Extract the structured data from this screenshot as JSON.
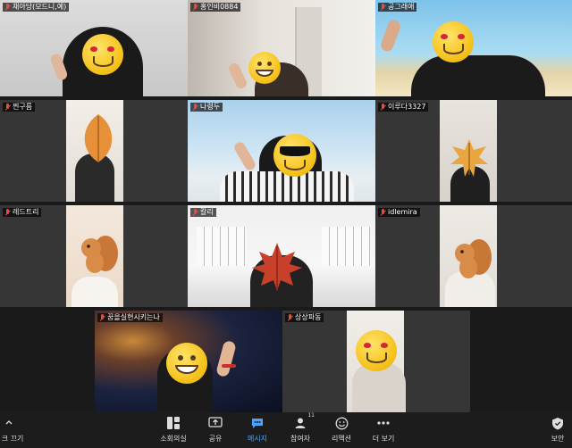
{
  "participants": [
    {
      "id": "p1",
      "name": "채아당(모드니,예)"
    },
    {
      "id": "p2",
      "name": "홍인비0884"
    },
    {
      "id": "p3",
      "name": "공그래애"
    },
    {
      "id": "p4",
      "name": "찐구름"
    },
    {
      "id": "p5",
      "name": "나령두"
    },
    {
      "id": "p6",
      "name": "이루다3327"
    },
    {
      "id": "p7",
      "name": "레드트리"
    },
    {
      "id": "p8",
      "name": "칼리"
    },
    {
      "id": "p9",
      "name": "idlemira"
    },
    {
      "id": "p10",
      "name": "꿈을실현시키는나"
    },
    {
      "id": "p11",
      "name": "상상파동"
    }
  ],
  "toolbar": {
    "left_label": "크 끄기",
    "items": [
      {
        "label": "소회의실",
        "icon": "breakout-rooms-icon"
      },
      {
        "label": "공유",
        "icon": "share-screen-icon"
      },
      {
        "label": "메시지",
        "icon": "chat-icon"
      },
      {
        "label": "참여자",
        "icon": "participants-icon",
        "badge": "11"
      },
      {
        "label": "리액션",
        "icon": "reactions-icon"
      },
      {
        "label": "더 보기",
        "icon": "more-icon"
      }
    ],
    "right_label": "보안"
  },
  "colors": {
    "active_border": "#58d68d",
    "accent": "#4aa3ff",
    "muted": "#e74c3c"
  }
}
